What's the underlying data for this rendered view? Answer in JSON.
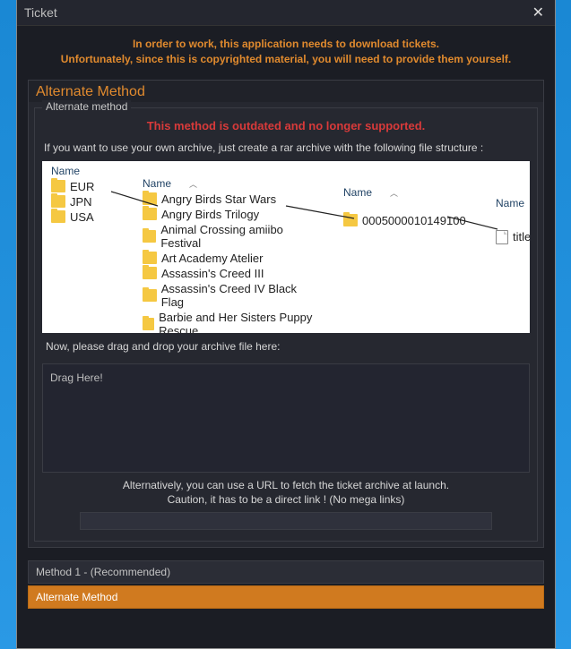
{
  "titlebar": {
    "title": "Ticket",
    "close": "✕"
  },
  "notice_line1": "In order to work, this application needs to download tickets.",
  "notice_line2": "Unfortunately, since this is copyrighted material, you will need to provide them yourself.",
  "panel": {
    "header": "Alternate Method",
    "fieldset_legend": "Alternate method",
    "warning": "This method is outdated and no longer supported.",
    "instruction": "If you want to use your own archive, just create a rar archive with the following file structure :",
    "drag_instruction": "Now, please drag and drop your archive file here:",
    "drag_label": "Drag Here!",
    "url_hint_line1": "Alternatively, you can use a URL to fetch the ticket archive at launch.",
    "url_hint_line2": "Caution, it has to be a direct link ! (No mega links)",
    "url_value": ""
  },
  "explorer": {
    "column_header": "Name",
    "col1": [
      "EUR",
      "JPN",
      "USA"
    ],
    "col2": [
      "Angry Birds Star Wars",
      "Angry Birds Trilogy",
      "Animal Crossing amiibo Festival",
      "Art Academy Atelier",
      "Assassin's Creed III",
      "Assassin's Creed IV Black Flag",
      "Barbie and Her Sisters Puppy Rescue"
    ],
    "col3": [
      "0005000010149100"
    ],
    "col4": [
      "title.tik"
    ]
  },
  "tabs": {
    "method1": "Method 1 - (Recommended)",
    "alternate": "Alternate Method"
  }
}
